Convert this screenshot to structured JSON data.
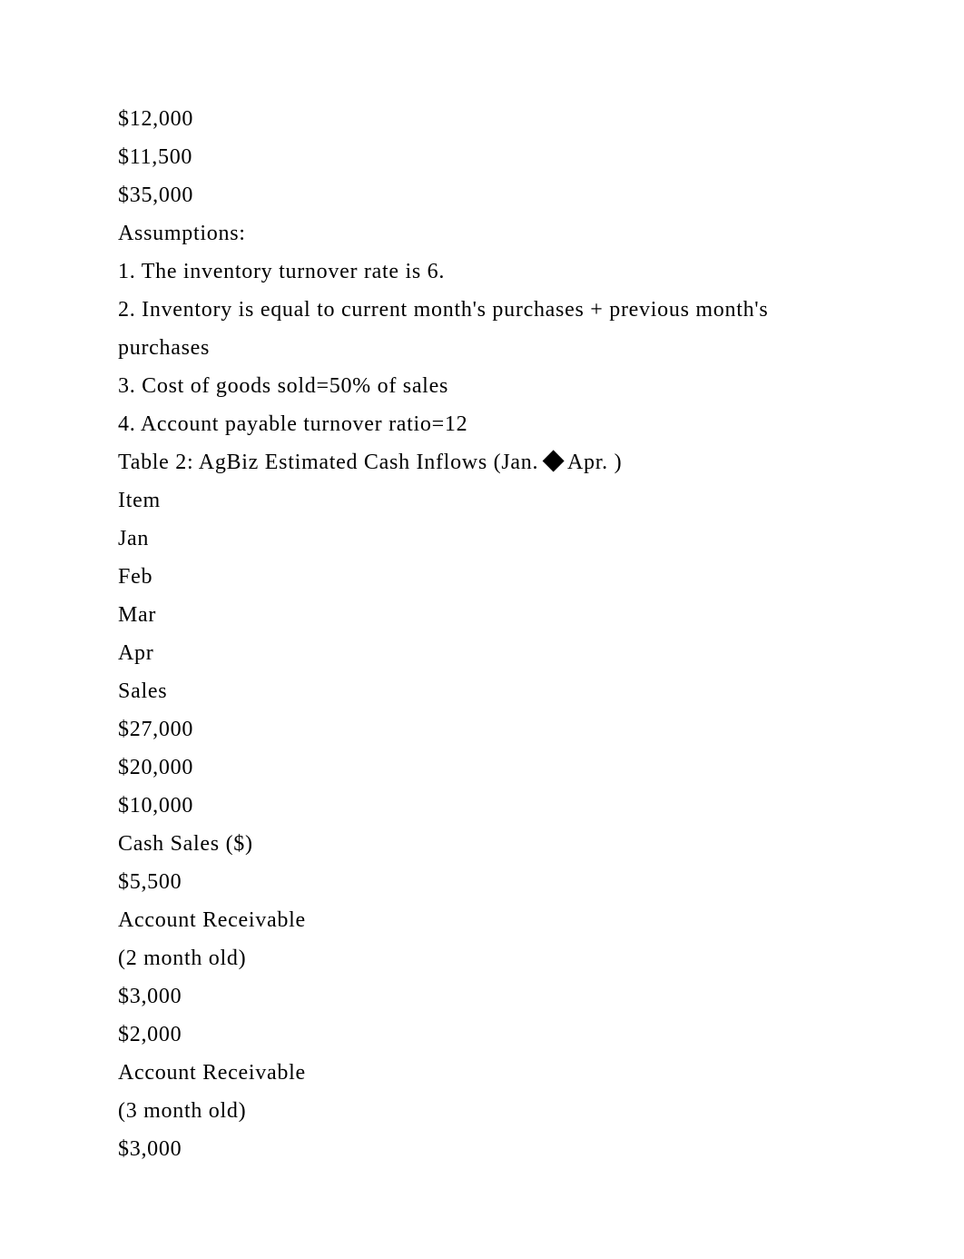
{
  "lines": [
    "$12,000",
    "$11,500",
    "$35,000",
    "Assumptions:",
    "1. The inventory turnover rate is 6.",
    "2. Inventory is equal to current month's purchases + previous month's purchases",
    "3. Cost of goods sold=50% of sales",
    "4. Account payable turnover ratio=12",
    "Table 2: AgBiz Estimated Cash Inflows (Jan. {DIAMOND} Apr. )",
    "Item",
    "Jan",
    "Feb",
    "Mar",
    "Apr",
    "Sales",
    "$27,000",
    "$20,000",
    "$10,000",
    "Cash Sales ($)",
    "$5,500",
    "Account Receivable",
    "(2 month old)",
    "$3,000",
    "$2,000",
    "Account Receivable",
    "(3 month old)",
    "$3,000"
  ]
}
